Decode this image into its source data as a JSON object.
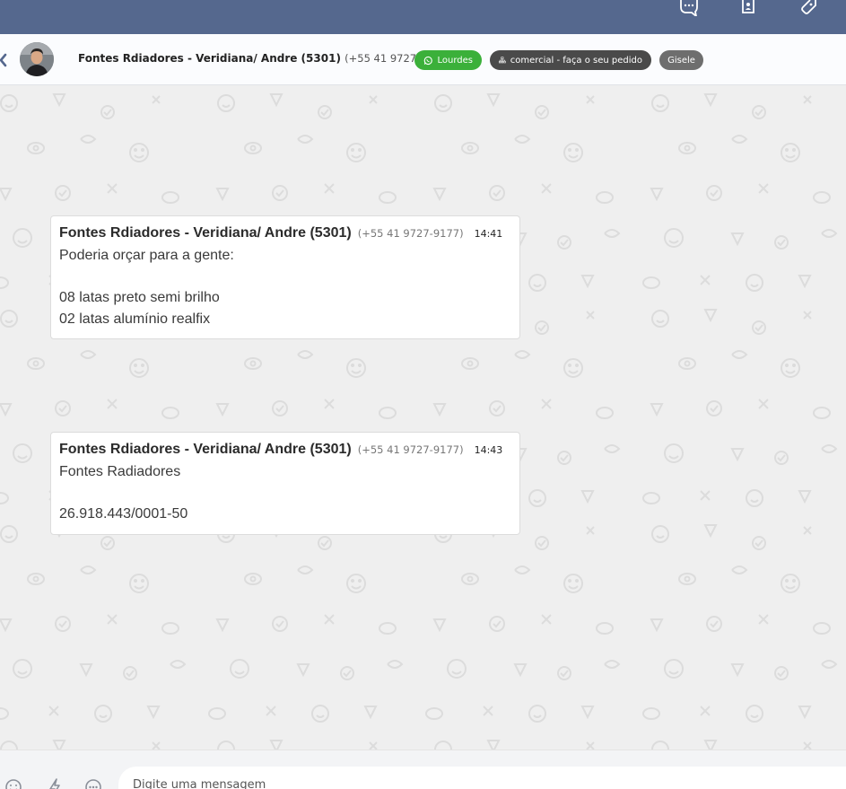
{
  "topbar": {
    "icons": [
      "chat-bubbles-icon",
      "contact-card-icon",
      "tag-icon"
    ],
    "background": "#55688e"
  },
  "header": {
    "contact_name": "Fontes Rdiadores - Veridiana/ Andre (5301)",
    "contact_phone": "(+55 41 9727-9177)",
    "tags": [
      {
        "label": "Lourdes",
        "icon": "whatsapp-icon",
        "color": "#3bb03a"
      },
      {
        "label": "comercial - faça o seu pedido",
        "icon": "org-chart-icon",
        "color": "#4a4a4a"
      },
      {
        "label": "Gisele",
        "color": "#6e6e6e"
      }
    ]
  },
  "messages": [
    {
      "sender": "Fontes Rdiadores - Veridiana/ Andre (5301)",
      "phone": "(+55 41 9727-9177)",
      "time": "14:41",
      "lines": [
        "Poderia orçar para a gente:",
        "",
        "08 latas preto semi brilho",
        "02 latas alumínio realfix"
      ]
    },
    {
      "sender": "Fontes Rdiadores - Veridiana/ Andre (5301)",
      "phone": "(+55 41 9727-9177)",
      "time": "14:43",
      "lines": [
        "Fontes Radiadores",
        "",
        "26.918.443/0001-50"
      ]
    }
  ],
  "composer": {
    "placeholder": "Digite uma mensagem",
    "icons": [
      "emoji-icon",
      "lightning-icon",
      "more-options-icon"
    ]
  }
}
